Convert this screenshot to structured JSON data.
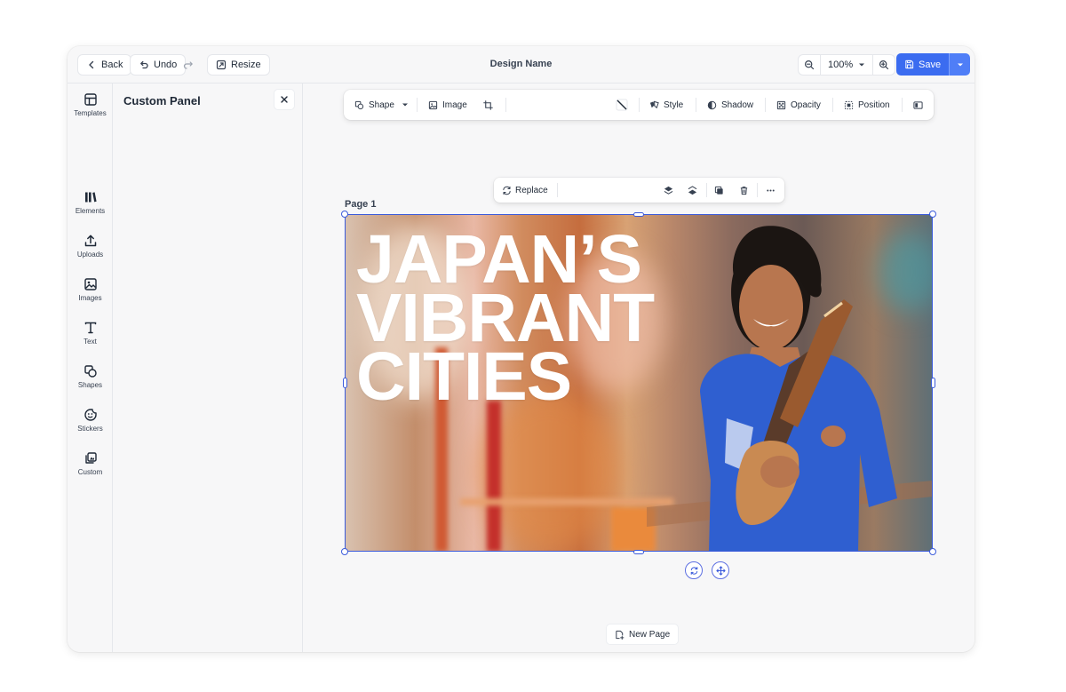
{
  "header": {
    "back_label": "Back",
    "undo_label": "Undo",
    "resize_label": "Resize",
    "design_name": "Design Name",
    "zoom_value": "100%",
    "save_label": "Save"
  },
  "sidebar": {
    "items": [
      {
        "label": "Templates",
        "icon": "templates-icon"
      },
      {
        "label": "Elements",
        "icon": "elements-icon"
      },
      {
        "label": "Uploads",
        "icon": "upload-icon"
      },
      {
        "label": "Images",
        "icon": "image-icon"
      },
      {
        "label": "Text",
        "icon": "text-icon"
      },
      {
        "label": "Shapes",
        "icon": "shapes-icon"
      },
      {
        "label": "Stickers",
        "icon": "sticker-icon"
      },
      {
        "label": "Custom",
        "icon": "custom-icon"
      }
    ]
  },
  "panel": {
    "title": "Custom Panel"
  },
  "toolbar": {
    "shape_label": "Shape",
    "image_label": "Image",
    "style_label": "Style",
    "shadow_label": "Shadow",
    "opacity_label": "Opacity",
    "position_label": "Position"
  },
  "element_toolbar": {
    "replace_label": "Replace"
  },
  "page": {
    "label": "Page 1",
    "headline": [
      "JAPAN’S",
      "VIBRANT",
      "CITIES"
    ],
    "new_page_label": "New Page"
  },
  "colors": {
    "accent": "#3b6cf0",
    "selection": "#3b5bdb"
  }
}
